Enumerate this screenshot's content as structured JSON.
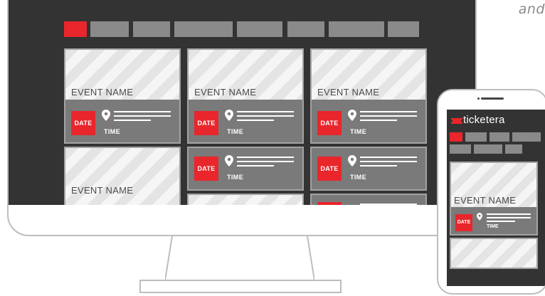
{
  "tagline_fragment": "and",
  "monitor": {
    "nav_pills": [
      {
        "active": true
      },
      {
        "active": false
      },
      {
        "active": false
      },
      {
        "active": false
      },
      {
        "active": false
      },
      {
        "active": false
      },
      {
        "active": false
      },
      {
        "active": false
      }
    ],
    "cards": [
      {
        "event_name": "EVENT NAME",
        "date": "DATE",
        "time": "TIME"
      },
      {
        "event_name": "EVENT NAME",
        "date": "DATE",
        "time": "TIME"
      },
      {
        "event_name": "EVENT NAME",
        "date": "DATE",
        "time": "TIME"
      },
      {
        "event_name": "EVENT NAME"
      },
      {
        "date": "DATE",
        "time": "TIME"
      },
      {
        "date": "DATE",
        "time": "TIME"
      }
    ]
  },
  "phone": {
    "logo": "ticketera",
    "event_name": "EVENT NAME",
    "date": "DATE",
    "time": "TIME"
  },
  "colors": {
    "accent": "#e8262b",
    "screen_bg": "#333333",
    "card_bg": "#7a7a7a",
    "pill_gray": "#8a8a8a"
  },
  "icons": [
    "location-pin-icon",
    "ticket-logo-icon"
  ]
}
